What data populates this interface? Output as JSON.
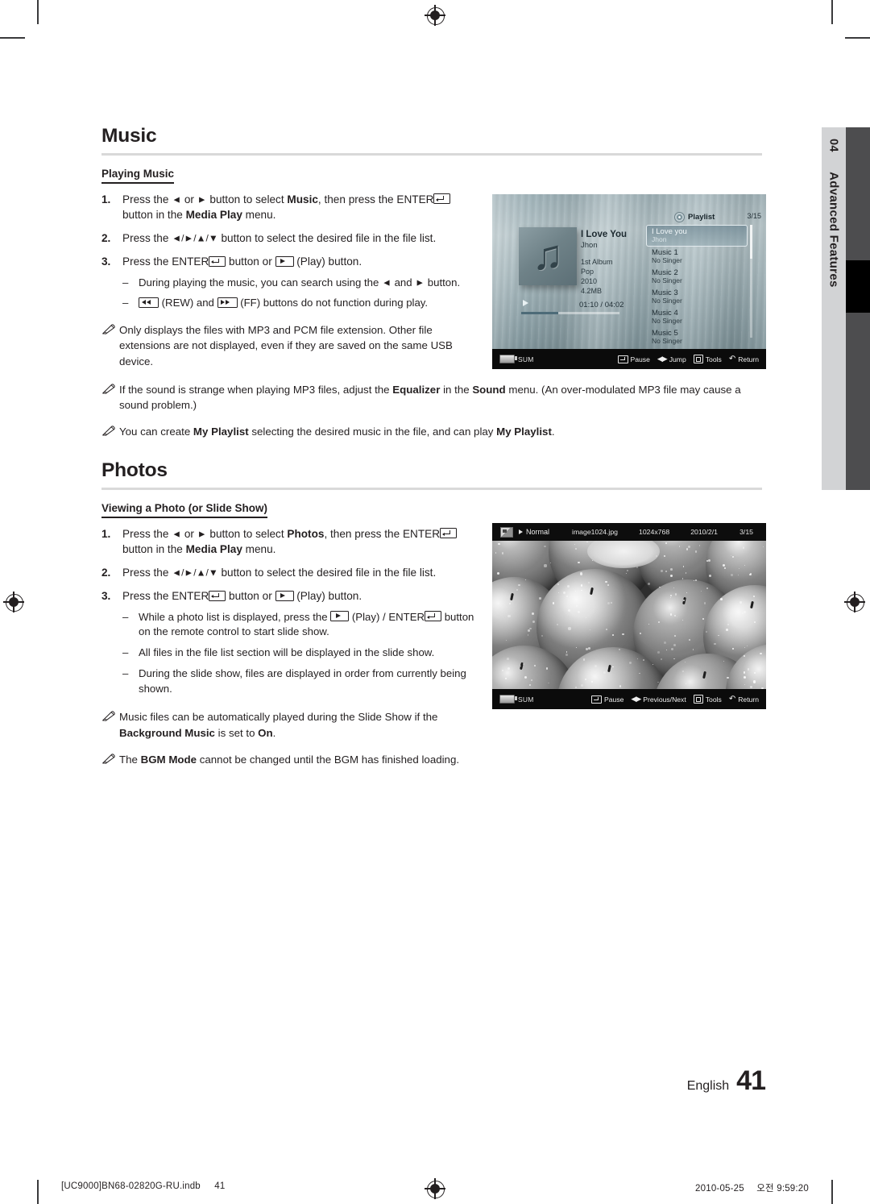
{
  "chapter": {
    "number": "04",
    "label": "Advanced Features"
  },
  "sections": [
    {
      "heading": "Music",
      "subheading": "Playing Music",
      "steps": [
        {
          "num": "1.",
          "parts": [
            {
              "t": "Press the "
            },
            {
              "t": "◄",
              "k": "arrow"
            },
            {
              "t": " or "
            },
            {
              "t": "►",
              "k": "arrow"
            },
            {
              "t": " button to select "
            },
            {
              "t": "Music",
              "b": true
            },
            {
              "t": ", then press the "
            },
            {
              "t": "ENTER",
              "nb": true
            },
            {
              "t": "[enter]",
              "k": "enter"
            },
            {
              "t": " button in the "
            },
            {
              "t": "Media Play",
              "b": true
            },
            {
              "t": " menu."
            }
          ]
        },
        {
          "num": "2.",
          "parts": [
            {
              "t": "Press the "
            },
            {
              "t": "◄/►/▲/▼",
              "k": "arrow"
            },
            {
              "t": " button to select the desired file in the file list."
            }
          ]
        },
        {
          "num": "3.",
          "parts": [
            {
              "t": "Press the ENTER"
            },
            {
              "t": "[enter]",
              "k": "enter"
            },
            {
              "t": " button or "
            },
            {
              "t": "[play]",
              "k": "play"
            },
            {
              "t": " (Play) button."
            }
          ],
          "sub": [
            {
              "parts": [
                {
                  "t": "During playing the music, you can search using the "
                },
                {
                  "t": "◄",
                  "k": "arrow"
                },
                {
                  "t": " and "
                },
                {
                  "t": "►",
                  "k": "arrow"
                },
                {
                  "t": " button."
                }
              ]
            },
            {
              "parts": [
                {
                  "t": "[rew]",
                  "k": "rew"
                },
                {
                  "t": " (REW) and "
                },
                {
                  "t": "[ff]",
                  "k": "ff"
                },
                {
                  "t": " (FF) buttons do not function during play."
                }
              ]
            }
          ]
        }
      ],
      "notes": [
        {
          "parts": [
            {
              "t": "Only displays the files with MP3 and PCM file extension. Other file extensions are not displayed, even if they are saved on the same USB device."
            }
          ]
        },
        {
          "parts": [
            {
              "t": "If the sound is strange when playing MP3 files, adjust the "
            },
            {
              "t": "Equalizer",
              "b": true
            },
            {
              "t": " in the "
            },
            {
              "t": "Sound",
              "b": true
            },
            {
              "t": " menu. (An over-modulated MP3 file may cause a sound problem.)"
            }
          ]
        },
        {
          "parts": [
            {
              "t": "You can create "
            },
            {
              "t": "My Playlist",
              "b": true
            },
            {
              "t": " selecting the desired music in the file, and can play "
            },
            {
              "t": "My Playlist",
              "b": true
            },
            {
              "t": "."
            }
          ]
        }
      ]
    },
    {
      "heading": "Photos",
      "subheading": "Viewing a Photo (or Slide Show)",
      "steps": [
        {
          "num": "1.",
          "parts": [
            {
              "t": "Press the "
            },
            {
              "t": "◄",
              "k": "arrow"
            },
            {
              "t": " or "
            },
            {
              "t": "►",
              "k": "arrow"
            },
            {
              "t": " button to select "
            },
            {
              "t": "Photos",
              "b": true
            },
            {
              "t": ", then press the "
            },
            {
              "t": "ENTER",
              "nb": true
            },
            {
              "t": "[enter]",
              "k": "enter"
            },
            {
              "t": " button in the "
            },
            {
              "t": "Media Play",
              "b": true
            },
            {
              "t": " menu."
            }
          ]
        },
        {
          "num": "2.",
          "parts": [
            {
              "t": "Press the "
            },
            {
              "t": "◄/►/▲/▼",
              "k": "arrow"
            },
            {
              "t": " button to select the desired file in the file list."
            }
          ]
        },
        {
          "num": "3.",
          "parts": [
            {
              "t": "Press the ENTER"
            },
            {
              "t": "[enter]",
              "k": "enter"
            },
            {
              "t": " button or "
            },
            {
              "t": "[play]",
              "k": "play"
            },
            {
              "t": " (Play) button."
            }
          ],
          "sub": [
            {
              "parts": [
                {
                  "t": "While a photo list is displayed, press the "
                },
                {
                  "t": "[play]",
                  "k": "play"
                },
                {
                  "t": " (Play) / ENTER"
                },
                {
                  "t": "[enter]",
                  "k": "enter"
                },
                {
                  "t": " button on the remote control to start slide show."
                }
              ]
            },
            {
              "parts": [
                {
                  "t": "All files in the file list section will be displayed in the slide show."
                }
              ]
            },
            {
              "parts": [
                {
                  "t": "During the slide show, files are displayed in order from currently being shown."
                }
              ]
            }
          ]
        }
      ],
      "notes": [
        {
          "parts": [
            {
              "t": "Music files can be automatically played during the Slide Show if the "
            },
            {
              "t": "Background Music",
              "b": true
            },
            {
              "t": " is set to "
            },
            {
              "t": "On",
              "b": true
            },
            {
              "t": "."
            }
          ]
        },
        {
          "parts": [
            {
              "t": "The "
            },
            {
              "t": "BGM Mode",
              "b": true
            },
            {
              "t": " cannot be changed until the BGM has finished loading."
            }
          ]
        }
      ]
    }
  ],
  "music_screenshot": {
    "track_title": "I Love You",
    "track_artist": "Jhon",
    "meta_lines": [
      "1st Album",
      "Pop",
      "2010",
      "4.2MB"
    ],
    "elapsed_total": "01:10 / 04:02",
    "playlist_label": "Playlist",
    "playlist_count": "3/15",
    "playlist_items": [
      {
        "title": "I Love you",
        "singer": "Jhon",
        "selected": true
      },
      {
        "title": "Music 1",
        "singer": "No Singer",
        "selected": false
      },
      {
        "title": "Music 2",
        "singer": "No Singer",
        "selected": false
      },
      {
        "title": "Music 3",
        "singer": "No Singer",
        "selected": false
      },
      {
        "title": "Music 4",
        "singer": "No Singer",
        "selected": false
      },
      {
        "title": "Music 5",
        "singer": "No Singer",
        "selected": false
      }
    ],
    "device_label": "SUM",
    "osd_keys": [
      {
        "glyph": "enter",
        "label": "Pause"
      },
      {
        "glyph": "leftright",
        "label": "Jump"
      },
      {
        "glyph": "tools",
        "label": "Tools"
      },
      {
        "glyph": "return",
        "label": "Return"
      }
    ]
  },
  "photo_screenshot": {
    "mode": "Normal",
    "filename": "image1024.jpg",
    "resolution": "1024x768",
    "date": "2010/2/1",
    "count": "3/15",
    "device_label": "SUM",
    "osd_keys": [
      {
        "glyph": "enter",
        "label": "Pause"
      },
      {
        "glyph": "leftright",
        "label": "Previous/Next"
      },
      {
        "glyph": "tools",
        "label": "Tools"
      },
      {
        "glyph": "return",
        "label": "Return"
      }
    ]
  },
  "page_footer": {
    "language": "English",
    "page_number": "41",
    "file_name": "[UC9000]BN68-02820G-RU.indb",
    "file_page": "41",
    "print_date": "2010-05-25",
    "print_time": "오전 9:59:20"
  }
}
